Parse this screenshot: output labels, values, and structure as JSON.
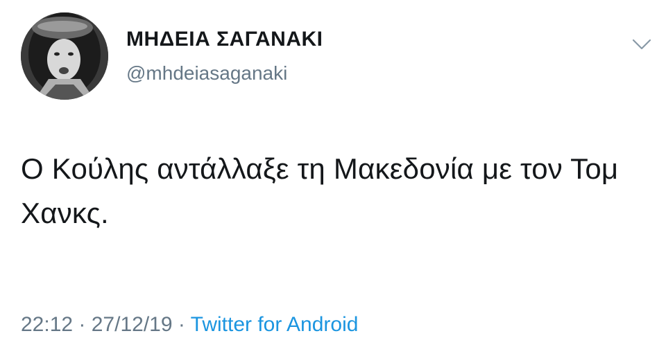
{
  "author": {
    "display_name": "ΜΗΔΕΙΑ ΣΑΓΑΝΑΚΙ",
    "handle": "@mhdeiasaganaki",
    "avatar_icon": "profile-photo"
  },
  "menu": {
    "icon": "chevron-down-icon"
  },
  "tweet": {
    "text": "Ο Κούλης αντάλλαξε τη Μακεδονία με τον Τομ Χανκς."
  },
  "meta": {
    "time": "22:12",
    "separator1": " · ",
    "date": "27/12/19",
    "separator2": " · ",
    "source": "Twitter for Android"
  },
  "colors": {
    "text": "#14171a",
    "secondary": "#657786",
    "link": "#1b95e0"
  }
}
